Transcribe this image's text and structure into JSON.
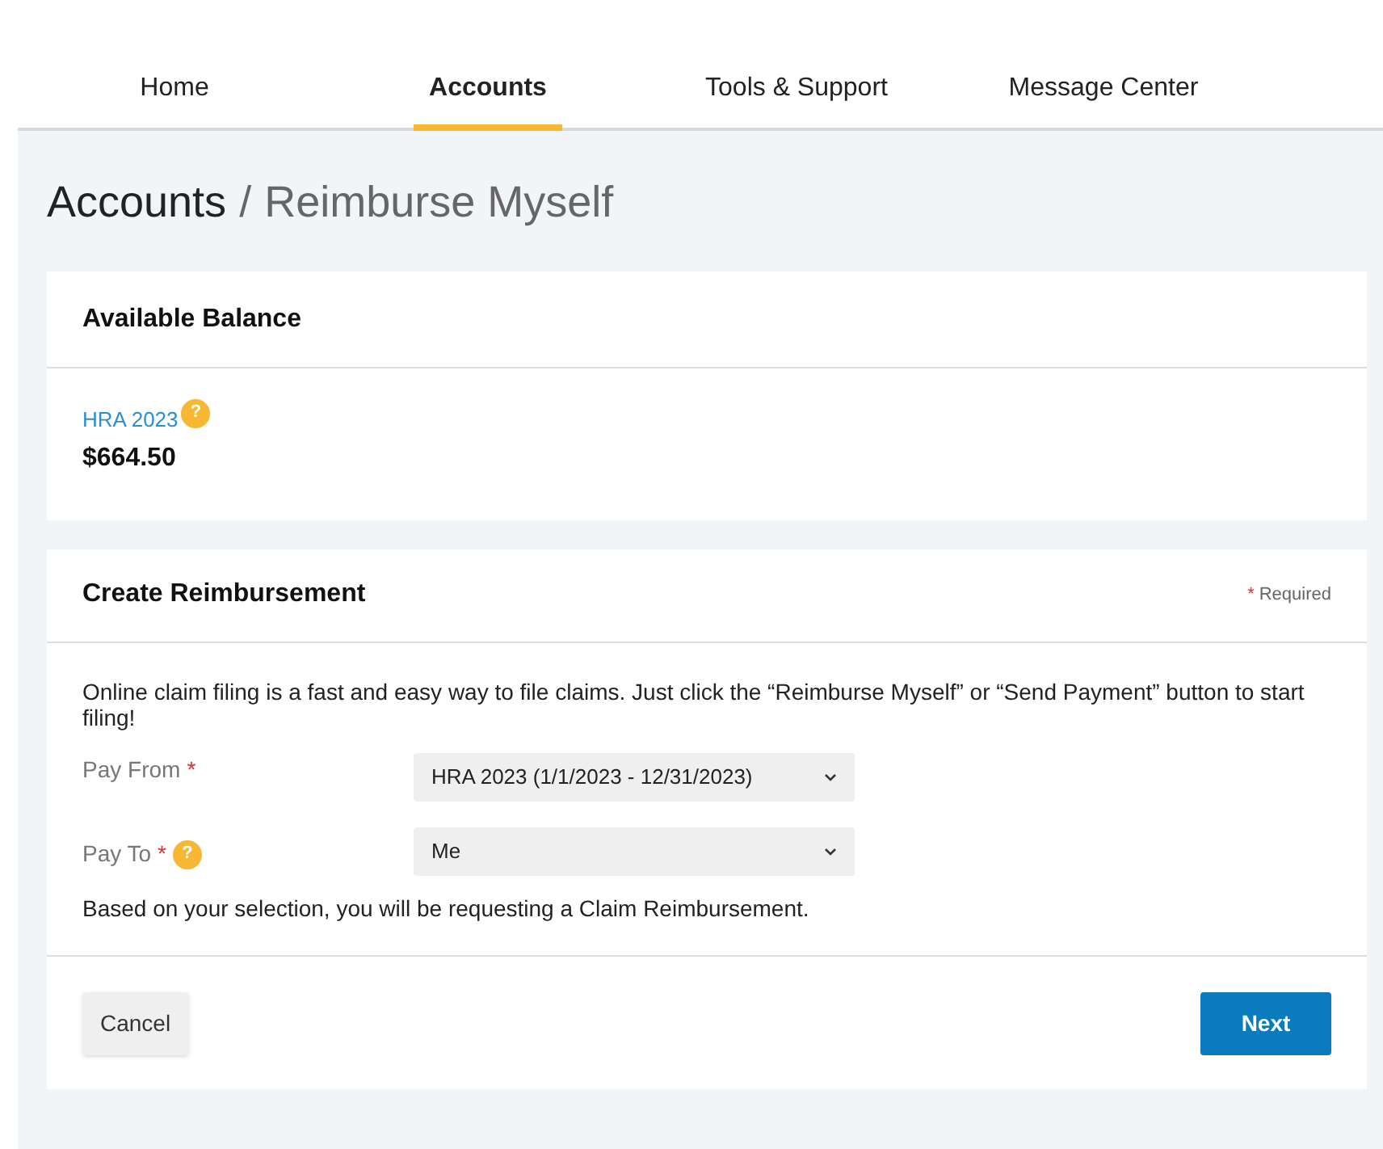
{
  "nav": {
    "tabs": [
      {
        "label": "Home",
        "selected": false
      },
      {
        "label": "Accounts",
        "selected": true
      },
      {
        "label": "Tools & Support",
        "selected": false
      },
      {
        "label": "Message Center",
        "selected": false
      }
    ]
  },
  "breadcrumb": {
    "parent": "Accounts",
    "separator": "/",
    "current": "Reimburse Myself"
  },
  "balance_card": {
    "title": "Available Balance",
    "account": "HRA 2023",
    "help": "?",
    "amount": "$664.50"
  },
  "reimbursement_card": {
    "title": "Create Reimbursement",
    "required_mark": "*",
    "required_label": "Required",
    "intro": "Online claim filing is a fast and easy way to file claims. Just click the “Reimburse Myself” or “Send Payment” button to start filing!",
    "fields": [
      {
        "label": "Pay From",
        "required_mark": "*",
        "value": "HRA 2023 (1/1/2023 - 12/31/2023)"
      },
      {
        "label": "Pay To",
        "required_mark": "*",
        "help": "?",
        "value": "Me"
      }
    ],
    "note": "Based on your selection, you will be requesting a Claim Reimbursement.",
    "buttons": [
      {
        "label": "Cancel",
        "kind": "secondary"
      },
      {
        "label": "Next",
        "kind": "primary"
      }
    ]
  }
}
